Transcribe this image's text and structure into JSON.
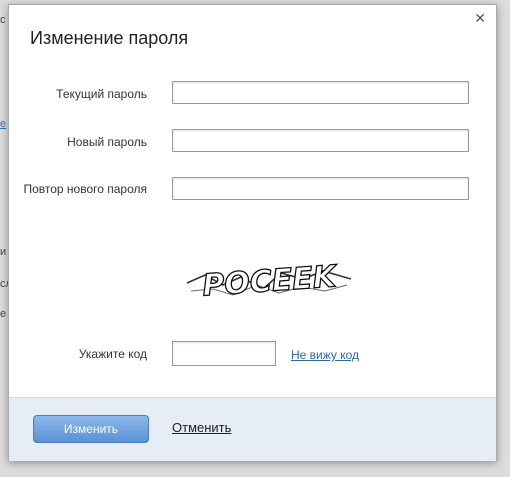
{
  "dialog": {
    "title": "Изменение пароля",
    "close_icon": "close-icon"
  },
  "form": {
    "current_password_label": "Текущий пароль",
    "new_password_label": "Новый пароль",
    "repeat_password_label": "Повтор нового пароля",
    "current_password_value": "",
    "new_password_value": "",
    "repeat_password_value": "",
    "captcha_text": "POCEEK",
    "code_label": "Укажите код",
    "code_value": "",
    "cant_see_link": "Не вижу код"
  },
  "footer": {
    "submit_label": "Изменить",
    "cancel_label": "Отменить"
  },
  "colors": {
    "accent": "#5a91d6",
    "link": "#2a6aa8",
    "footer_bg": "#e7edf5"
  }
}
